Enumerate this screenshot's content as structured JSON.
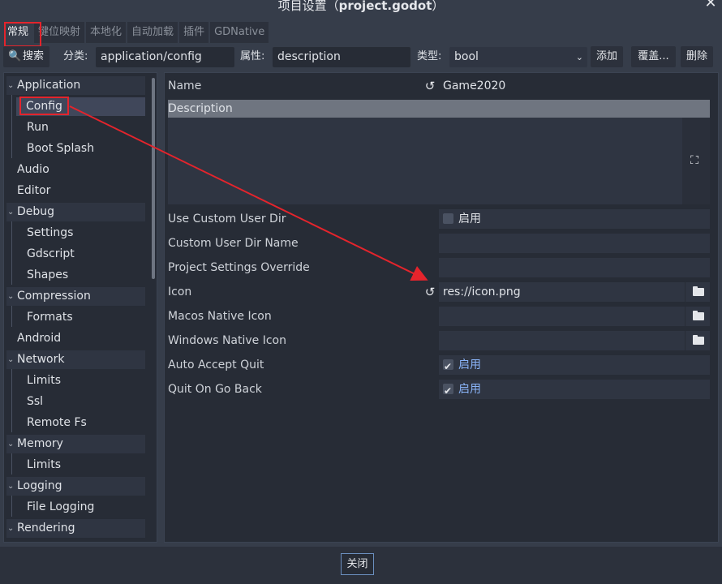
{
  "window": {
    "title_prefix": "项目设置（",
    "title_project": "project.godot",
    "title_suffix": "）"
  },
  "tabs": [
    "常规",
    "键位映射",
    "本地化",
    "自动加载",
    "插件",
    "GDNative"
  ],
  "toolbar": {
    "search_label": "搜索",
    "category_label": "分类:",
    "category_value": "application/config",
    "property_label": "属性:",
    "property_value": "description",
    "type_label": "类型:",
    "type_value": "bool",
    "add_label": "添加",
    "override_label": "覆盖...",
    "delete_label": "删除"
  },
  "tree": {
    "items": [
      {
        "label": "Application",
        "level": 0,
        "expanded": true
      },
      {
        "label": "Config",
        "level": 1,
        "selected": true
      },
      {
        "label": "Run",
        "level": 1
      },
      {
        "label": "Boot Splash",
        "level": 1
      },
      {
        "label": "Audio",
        "level": 0
      },
      {
        "label": "Editor",
        "level": 0
      },
      {
        "label": "Debug",
        "level": 0,
        "expanded": true
      },
      {
        "label": "Settings",
        "level": 1
      },
      {
        "label": "Gdscript",
        "level": 1
      },
      {
        "label": "Shapes",
        "level": 1
      },
      {
        "label": "Compression",
        "level": 0,
        "expanded": true
      },
      {
        "label": "Formats",
        "level": 1
      },
      {
        "label": "Android",
        "level": 0
      },
      {
        "label": "Network",
        "level": 0,
        "expanded": true
      },
      {
        "label": "Limits",
        "level": 1
      },
      {
        "label": "Ssl",
        "level": 1
      },
      {
        "label": "Remote Fs",
        "level": 1
      },
      {
        "label": "Memory",
        "level": 0,
        "expanded": true
      },
      {
        "label": "Limits",
        "level": 1
      },
      {
        "label": "Logging",
        "level": 0,
        "expanded": true
      },
      {
        "label": "File Logging",
        "level": 1
      },
      {
        "label": "Rendering",
        "level": 0,
        "expanded": true
      }
    ]
  },
  "properties": {
    "name_label": "Name",
    "name_value": "Game2020",
    "description_label": "Description",
    "use_custom_user_dir_label": "Use Custom User Dir",
    "use_custom_user_dir_check": "启用",
    "custom_user_dir_name_label": "Custom User Dir Name",
    "project_settings_override_label": "Project Settings Override",
    "icon_label": "Icon",
    "icon_value": "res://icon.png",
    "macos_native_icon_label": "Macos Native Icon",
    "windows_native_icon_label": "Windows Native Icon",
    "auto_accept_quit_label": "Auto Accept Quit",
    "auto_accept_quit_check": "启用",
    "quit_on_go_back_label": "Quit On Go Back",
    "quit_on_go_back_check": "启用"
  },
  "footer": {
    "close_label": "关闭"
  },
  "colors": {
    "background": "#363d4a",
    "panel": "#272c36",
    "accent_blue": "#8ab4f8",
    "highlight_red": "#e4242c"
  }
}
